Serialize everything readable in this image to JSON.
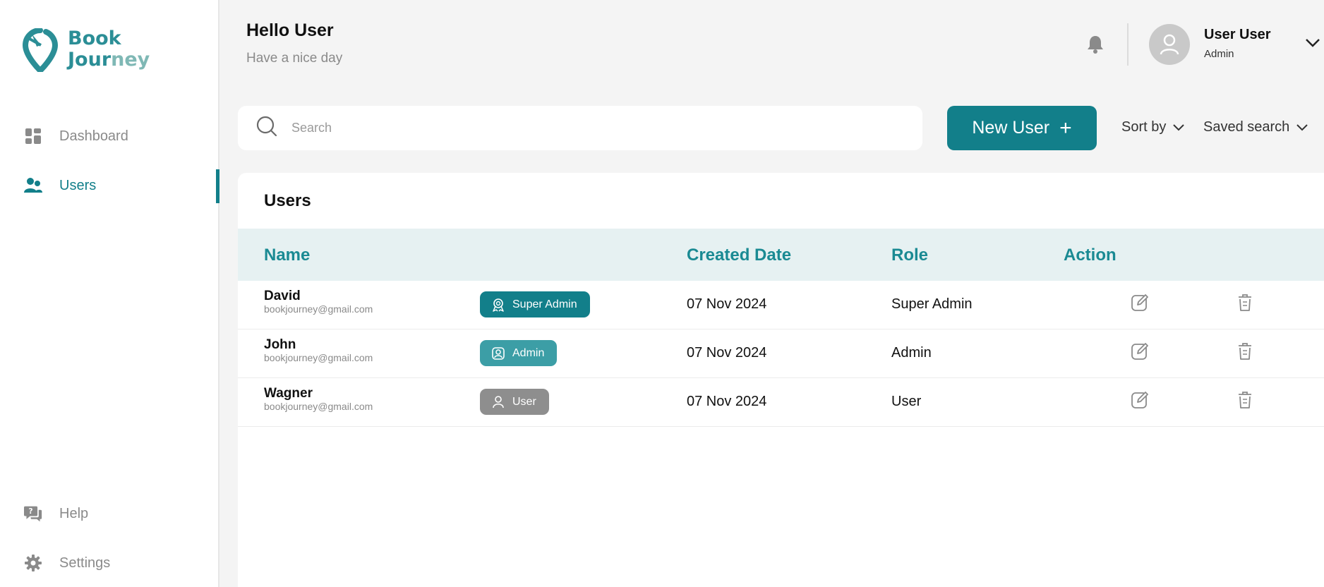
{
  "brand": {
    "line1": "Book",
    "line2_a": "Jour",
    "line2_b": "ney"
  },
  "sidebar": {
    "items": [
      {
        "label": "Dashboard",
        "icon": "dashboard-icon"
      },
      {
        "label": "Users",
        "icon": "users-icon",
        "active": true
      }
    ],
    "bottom": [
      {
        "label": "Help",
        "icon": "help-icon"
      },
      {
        "label": "Settings",
        "icon": "gear-icon"
      }
    ]
  },
  "header": {
    "title": "Hello User",
    "subtitle": "Have a nice day",
    "user_name": "User User",
    "user_role": "Admin"
  },
  "toolbar": {
    "search_placeholder": "Search",
    "new_user_label": "New User",
    "new_user_icon": "+",
    "sort_label": "Sort by",
    "saved_search_label": "Saved search"
  },
  "users_panel": {
    "title": "Users",
    "columns": {
      "name": "Name",
      "created": "Created Date",
      "role": "Role",
      "action": "Action"
    },
    "rows": [
      {
        "name": "David",
        "email": "bookjourney@gmail.com",
        "badge": "Super Admin",
        "created": "07 Nov 2024",
        "role": "Super Admin"
      },
      {
        "name": "John",
        "email": "bookjourney@gmail.com",
        "badge": "Admin",
        "created": "07 Nov 2024",
        "role": "Admin"
      },
      {
        "name": "Wagner",
        "email": "bookjourney@gmail.com",
        "badge": "User",
        "created": "07 Nov 2024",
        "role": "User"
      }
    ]
  },
  "colors": {
    "primary": "#127f8a",
    "admin_badge": "#3c9ea6",
    "user_badge": "#8e8e8e",
    "table_header_bg": "#e6f1f2"
  }
}
